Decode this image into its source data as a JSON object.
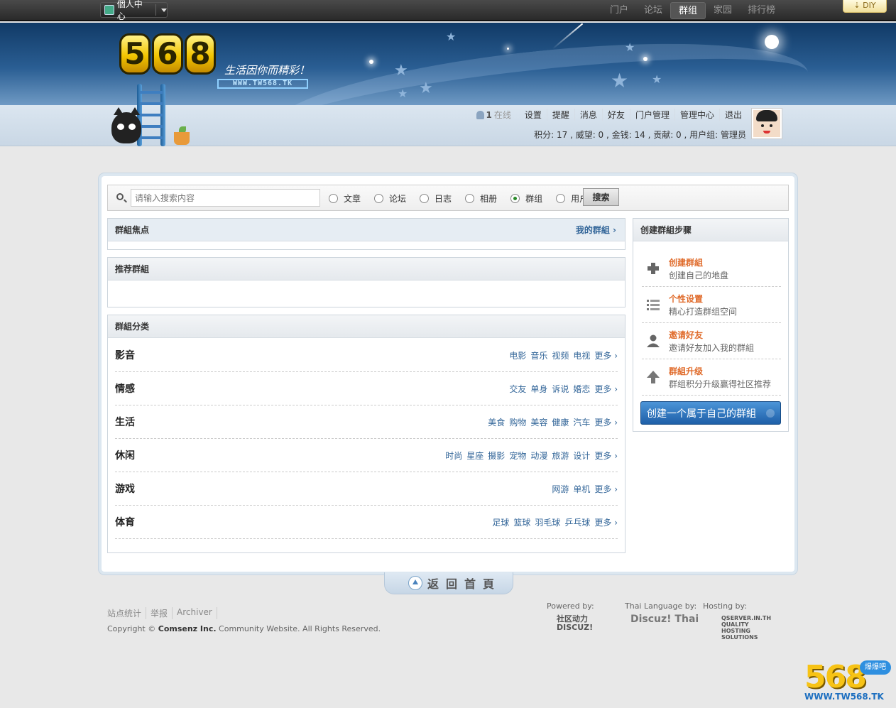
{
  "topbar": {
    "personal_center": "個人中心",
    "nav": [
      "门户",
      "论坛",
      "群组",
      "家园",
      "排行榜"
    ],
    "active_nav": "群组",
    "diy": "DIY"
  },
  "header": {
    "logo_text": "568",
    "slogan": "生活因你而精彩！",
    "logo_url": "WWW.TW568.TK"
  },
  "usermenu": {
    "online_count": "1",
    "online_label": "在线",
    "items": [
      "设置",
      "提醒",
      "消息",
      "好友",
      "门户管理",
      "管理中心",
      "退出"
    ],
    "credits": "积分: 17 , 威望: 0 , 金钱: 14 , 贡献: 0 , 用户组: 管理员"
  },
  "search": {
    "placeholder": "请输入搜索内容",
    "types": [
      "文章",
      "论坛",
      "日志",
      "相册",
      "群组",
      "用户"
    ],
    "selected": "群组",
    "button": "搜索"
  },
  "focus": {
    "title": "群組焦点",
    "my_groups": "我的群組 ›"
  },
  "recommend": {
    "title": "推荐群組"
  },
  "categories": {
    "title": "群組分类",
    "rows": [
      {
        "name": "影音",
        "links": [
          "电影",
          "音乐",
          "视频",
          "电视",
          "更多 ›"
        ]
      },
      {
        "name": "情感",
        "links": [
          "交友",
          "单身",
          "诉说",
          "婚恋",
          "更多 ›"
        ]
      },
      {
        "name": "生活",
        "links": [
          "美食",
          "购物",
          "美容",
          "健康",
          "汽车",
          "更多 ›"
        ]
      },
      {
        "name": "休闲",
        "links": [
          "时尚",
          "星座",
          "摄影",
          "宠物",
          "动漫",
          "旅游",
          "设计",
          "更多 ›"
        ]
      },
      {
        "name": "游戏",
        "links": [
          "网游",
          "单机",
          "更多 ›"
        ]
      },
      {
        "name": "体育",
        "links": [
          "足球",
          "篮球",
          "羽毛球",
          "乒乓球",
          "更多 ›"
        ]
      }
    ]
  },
  "steps": {
    "title": "创建群組步骤",
    "items": [
      {
        "title": "创建群組",
        "desc": "创建自己的地盘",
        "icon": "plus-icon"
      },
      {
        "title": "个性设置",
        "desc": "精心打造群组空间",
        "icon": "list-icon"
      },
      {
        "title": "邀请好友",
        "desc": "邀请好友加入我的群組",
        "icon": "user-icon"
      },
      {
        "title": "群組升级",
        "desc": "群组积分升级赢得社区推荐",
        "icon": "up-arrow-icon"
      }
    ],
    "create_button": "创建一个属于自己的群組"
  },
  "back_home": "返回首頁",
  "footer": {
    "links": [
      "站点统计",
      "举报",
      "Archiver"
    ],
    "copyright_prefix": "Copyright ©",
    "copyright_company": "Comsenz Inc.",
    "copyright_suffix": "Community Website. All Rights Reserved.",
    "powered_label": "Powered by:",
    "powered_badge": "社区动力 DISCUZ!",
    "thai_label": "Thai Language by:",
    "thai_badge": "Discuz! Thai",
    "hosting_label": "Hosting by:",
    "hosting_badge": "QSERVER.IN.TH QUALITY HOSTING SOLUTIONS"
  },
  "watermark": {
    "logo": "568",
    "url": "WWW.TW568.TK",
    "badge": "爆爆吧"
  }
}
